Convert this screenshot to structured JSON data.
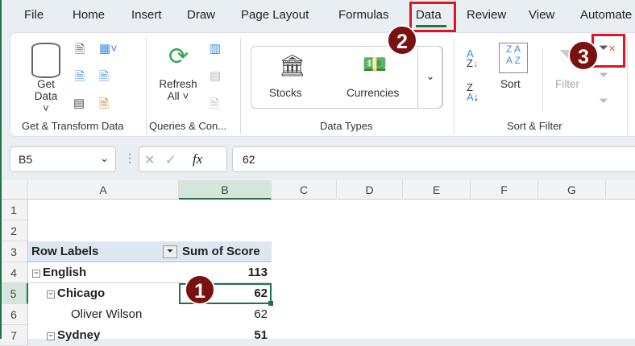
{
  "tabs": [
    "File",
    "Home",
    "Insert",
    "Draw",
    "Page Layout",
    "Formulas",
    "Data",
    "Review",
    "View",
    "Automate"
  ],
  "active_tab": "Data",
  "ribbon": {
    "get_data": [
      "Get",
      "Data"
    ],
    "refresh_all": [
      "Refresh",
      "All"
    ],
    "stocks": "Stocks",
    "currencies": "Currencies",
    "sort": "Sort",
    "filter": "Filter",
    "groups": [
      "Get & Transform Data",
      "Queries & Con...",
      "Data Types",
      "Sort & Filter"
    ]
  },
  "formula_bar": {
    "name_box": "B5",
    "fx": "fx",
    "value": "62"
  },
  "columns": [
    "A",
    "B",
    "C",
    "D",
    "E",
    "F",
    "G"
  ],
  "rows": [
    "1",
    "2",
    "3",
    "4",
    "5",
    "6",
    "7"
  ],
  "pivot": {
    "header": [
      "Row Labels",
      "Sum of Score"
    ],
    "rows": [
      {
        "label": "English",
        "value": "113",
        "bold": true,
        "level": 0
      },
      {
        "label": "Chicago",
        "value": "62",
        "bold": true,
        "level": 1
      },
      {
        "label": "Oliver Wilson",
        "value": "62",
        "bold": false,
        "level": 2
      },
      {
        "label": "Sydney",
        "value": "51",
        "bold": true,
        "level": 1
      }
    ]
  },
  "annotations": [
    "1",
    "2",
    "3"
  ],
  "colors": {
    "accent": "#217346",
    "highlight": "#e0141e",
    "badge": "#7a1010"
  }
}
